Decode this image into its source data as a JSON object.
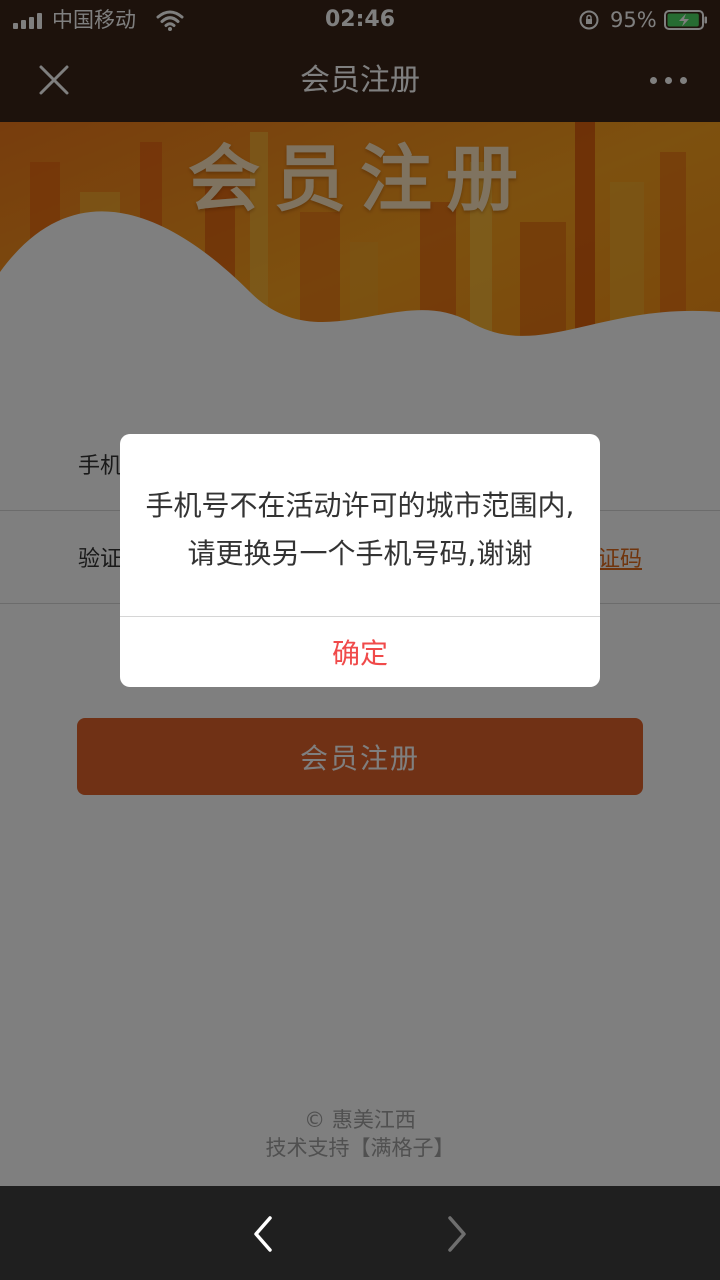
{
  "status_bar": {
    "carrier": "中国移动",
    "time": "02:46",
    "battery_percent": "95%",
    "battery_level": 0.95,
    "icons": [
      "signal-icon",
      "wifi-icon",
      "orientation-lock-icon",
      "battery-charging-icon"
    ]
  },
  "nav": {
    "title": "会员注册",
    "close_icon": "close-icon",
    "more_icon": "more-icon"
  },
  "banner": {
    "title": "会员注册"
  },
  "form": {
    "phone_label": "手机号",
    "code_label": "验证码",
    "get_code_label": "获取验证码",
    "submit_label": "会员注册"
  },
  "footer": {
    "copyright": "© 惠美江西",
    "support": "技术支持【满格子】"
  },
  "dialog": {
    "message": "手机号不在活动许可的城市范围内,请更换另一个手机号码,谢谢",
    "confirm_label": "确定"
  },
  "toolbar": {
    "back_icon": "chevron-left-icon",
    "forward_icon": "chevron-right-icon"
  },
  "colors": {
    "header_bg": "#3a2418",
    "button": "#e0622a",
    "link": "#e06a1c",
    "dialog_confirm": "#f04a4a",
    "toolbar_bg": "#1f1f1f"
  }
}
